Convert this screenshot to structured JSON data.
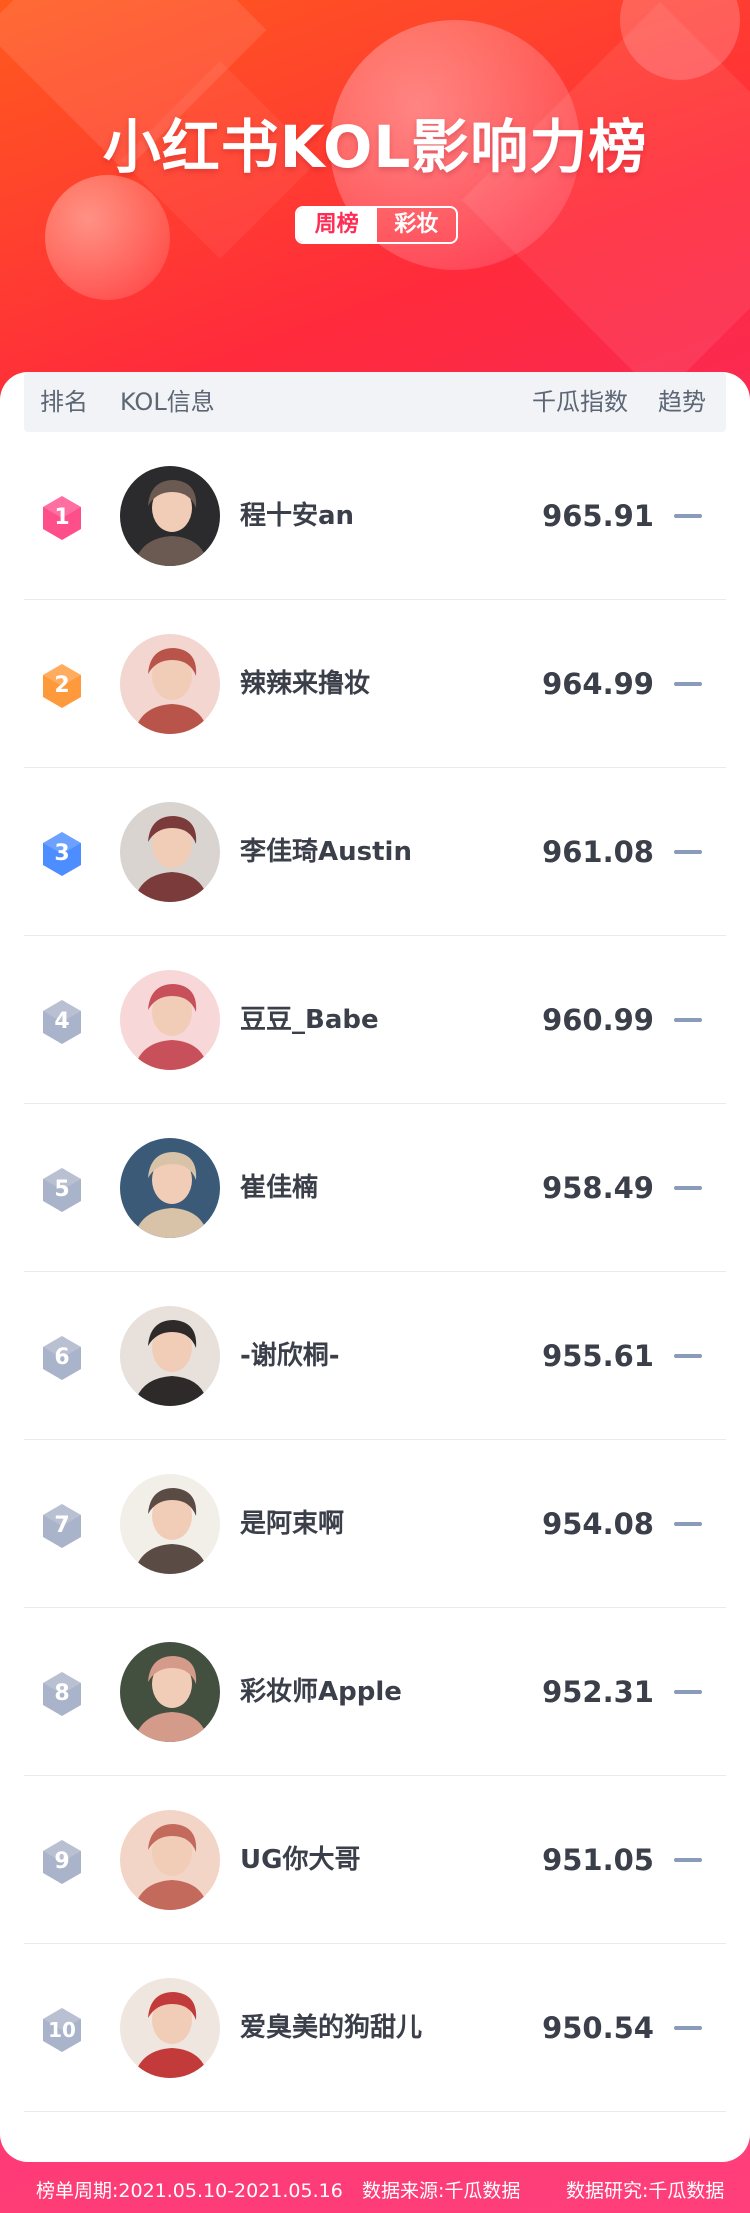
{
  "header": {
    "title": "小红书KOL影响力榜",
    "tabs": [
      {
        "label": "周榜",
        "active": true
      },
      {
        "label": "彩妆",
        "active": false
      }
    ]
  },
  "table": {
    "columns": {
      "rank": "排名",
      "info": "KOL信息",
      "index": "千瓜指数",
      "trend": "趋势"
    },
    "rows": [
      {
        "rank": "1",
        "name": "程十安an",
        "score": "965.91",
        "trend": "flat"
      },
      {
        "rank": "2",
        "name": "辣辣来撸妆",
        "score": "964.99",
        "trend": "flat"
      },
      {
        "rank": "3",
        "name": "李佳琦Austin",
        "score": "961.08",
        "trend": "flat"
      },
      {
        "rank": "4",
        "name": "豆豆_Babe",
        "score": "960.99",
        "trend": "flat"
      },
      {
        "rank": "5",
        "name": "崔佳楠",
        "score": "958.49",
        "trend": "flat"
      },
      {
        "rank": "6",
        "name": "-谢欣桐-",
        "score": "955.61",
        "trend": "flat"
      },
      {
        "rank": "7",
        "name": "是阿束啊",
        "score": "954.08",
        "trend": "flat"
      },
      {
        "rank": "8",
        "name": "彩妆师Apple",
        "score": "952.31",
        "trend": "flat"
      },
      {
        "rank": "9",
        "name": "UG你大哥",
        "score": "951.05",
        "trend": "flat"
      },
      {
        "rank": "10",
        "name": "爱臭美的狗甜儿",
        "score": "950.54",
        "trend": "flat"
      }
    ]
  },
  "footer": {
    "period": "榜单周期:2021.05.10-2021.05.16",
    "source": "数据来源:千瓜数据",
    "research": "数据研究:千瓜数据"
  },
  "colors": {
    "accent": "#ff2d55",
    "rank1": "#ff4f8b",
    "rank2": "#ff9a3c",
    "rank3": "#4c8dff",
    "rank_other": "#a9b3c9",
    "trend_flat": "#8a9bb8"
  },
  "icons": {
    "trend_flat": "dash-icon",
    "rank_badge": "hexagon-icon"
  }
}
